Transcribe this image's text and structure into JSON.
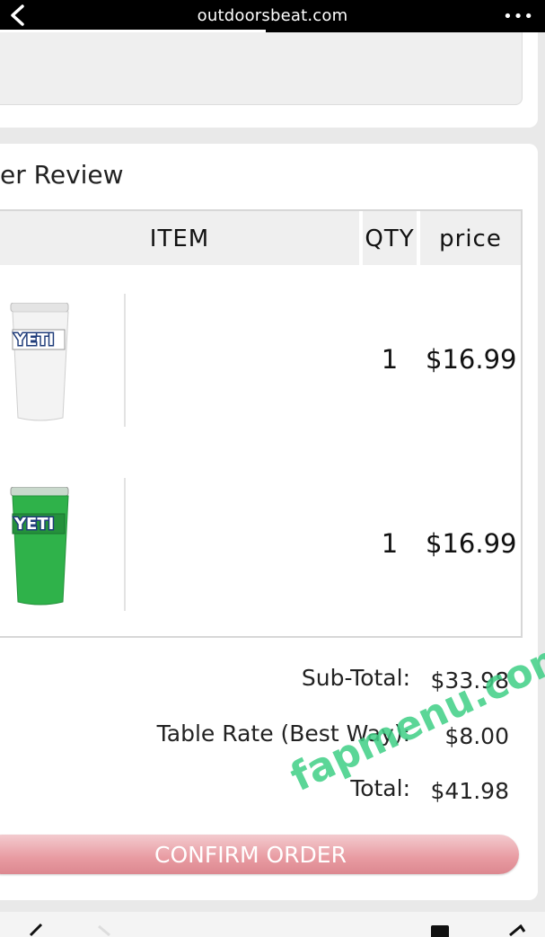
{
  "browser": {
    "url": "outdoorsbeat.com",
    "more_label": "•••"
  },
  "page": {
    "section_title": "er Review",
    "table": {
      "headers": {
        "item": "ITEM",
        "qty": "QTY",
        "price": "price"
      },
      "rows": [
        {
          "thumb_color": "#f0f0f0",
          "brand": "YETI",
          "qty": "1",
          "price": "$16.99"
        },
        {
          "thumb_color": "#2fb24a",
          "brand": "YETI",
          "qty": "1",
          "price": "$16.99"
        }
      ]
    },
    "totals": {
      "subtotal_label": "Sub-Total:",
      "subtotal_value": "$33.98",
      "shipping_label": "Table Rate (Best Way):",
      "shipping_value": "$8.00",
      "total_label": "Total:",
      "total_value": "$41.98"
    },
    "confirm_label": "CONFIRM ORDER"
  },
  "watermark": "fapmenu.com"
}
